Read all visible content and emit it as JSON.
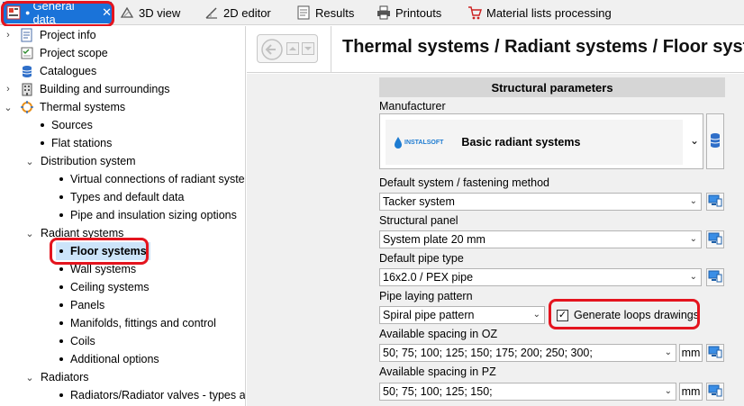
{
  "tabs": [
    {
      "label": "General data",
      "icon": "general-data-icon"
    },
    {
      "label": "3D view",
      "icon": "3d-view-icon"
    },
    {
      "label": "2D editor",
      "icon": "2d-editor-icon"
    },
    {
      "label": "Results",
      "icon": "results-icon"
    },
    {
      "label": "Printouts",
      "icon": "printer-icon"
    },
    {
      "label": "Material lists processing",
      "icon": "cart-icon"
    }
  ],
  "tree": {
    "project_info": "Project info",
    "project_scope": "Project scope",
    "catalogues": "Catalogues",
    "building": "Building and surroundings",
    "thermal": "Thermal systems",
    "sources": "Sources",
    "flat_stations": "Flat stations",
    "distribution": "Distribution system",
    "virtual_connections": "Virtual connections of radiant system",
    "types_default": "Types and default data",
    "pipe_sizing": "Pipe and insulation sizing options",
    "radiant": "Radiant systems",
    "floor": "Floor systems",
    "wall": "Wall systems",
    "ceiling": "Ceiling systems",
    "panels": "Panels",
    "manifolds": "Manifolds, fittings and control",
    "coils": "Coils",
    "additional": "Additional options",
    "radiators": "Radiators",
    "radiator_valves": "Radiators/Radiator valves - types and"
  },
  "header": {
    "title": "Thermal systems / Radiant systems / Floor syst"
  },
  "form": {
    "section": "Structural parameters",
    "manufacturer_label": "Manufacturer",
    "manufacturer_logo": "INSTALSOFT",
    "manufacturer_value": "Basic radiant systems",
    "default_system_label": "Default system / fastening method",
    "default_system_value": "Tacker system",
    "panel_label": "Structural panel",
    "panel_value": "System plate 20 mm",
    "pipe_type_label": "Default pipe type",
    "pipe_type_value": "16x2.0 / PEX pipe",
    "laying_label": "Pipe laying pattern",
    "laying_value": "Spiral pipe pattern",
    "generate_loops": "Generate loops drawings",
    "generate_loops_checked": true,
    "oz_label": "Available spacing in OZ",
    "oz_value": "50; 75; 100; 125; 150; 175; 200; 250; 300;",
    "pz_label": "Available spacing in PZ",
    "pz_value": "50; 75; 100; 125; 150;",
    "unit": "mm"
  },
  "colors": {
    "accent": "#1a73d9",
    "highlight": "#e4141e",
    "selection": "#cce4fa"
  }
}
